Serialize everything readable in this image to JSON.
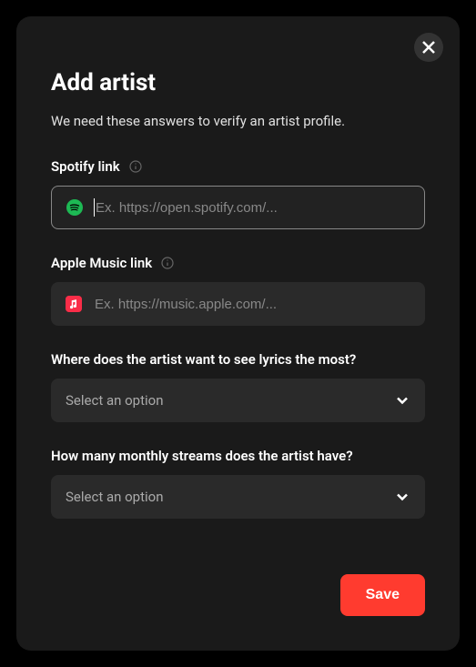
{
  "modal": {
    "title": "Add artist",
    "subtitle": "We need these answers to verify an artist profile.",
    "fields": {
      "spotify": {
        "label": "Spotify link",
        "placeholder": "Ex. https://open.spotify.com/...",
        "value": ""
      },
      "appleMusic": {
        "label": "Apple Music link",
        "placeholder": "Ex. https://music.apple.com/...",
        "value": ""
      },
      "lyricsPreference": {
        "label": "Where does the artist want to see lyrics the most?",
        "placeholder": "Select an option"
      },
      "monthlyStreams": {
        "label": "How many monthly streams does the artist have?",
        "placeholder": "Select an option"
      }
    },
    "saveLabel": "Save"
  }
}
